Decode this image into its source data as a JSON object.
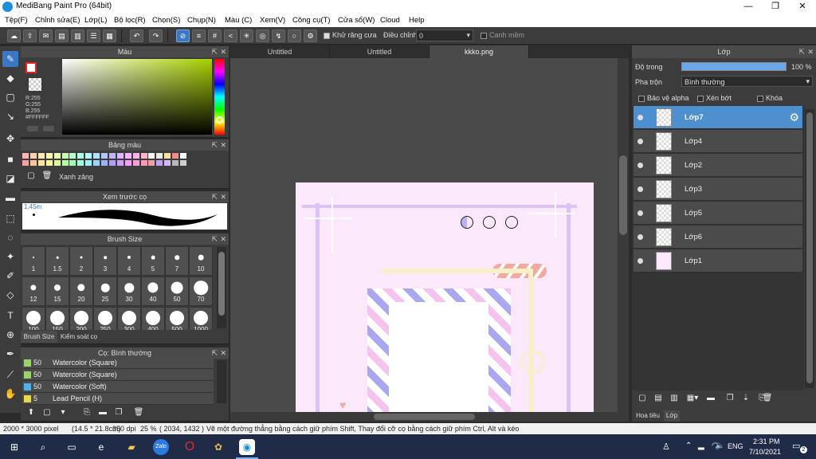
{
  "app": {
    "title": "MediBang Paint Pro (64bit)",
    "min": "—",
    "max": "❐",
    "close": "✕"
  },
  "menu": [
    "Tệp(F)",
    "Chỉnh sửa(E)",
    "Lớp(L)",
    "Bộ lọc(R)",
    "Chọn(S)",
    "Chụp(N)",
    "Màu (C)",
    "Xem(V)",
    "Công cụ(T)",
    "Cửa sổ(W)",
    "Cloud",
    "Help"
  ],
  "toolbar": {
    "antialias": "Khử răng cưa",
    "adjust_label": "Điều chỉnh",
    "adjust_value": "0",
    "smooth": "Canh mềm"
  },
  "color_panel": {
    "title": "Màu",
    "r": "R:255",
    "g": "G:255",
    "b": "B:255",
    "hex": "#FFFFFF"
  },
  "palette_panel": {
    "title": "Bảng màu",
    "name": "Xanh zảng"
  },
  "brush_preview": {
    "title": "Xem trước cọ",
    "size": "1.45m"
  },
  "brush_size": {
    "title": "Brush Size",
    "sizes": [
      "1",
      "1.5",
      "2",
      "3",
      "4",
      "5",
      "7",
      "10",
      "12",
      "15",
      "20",
      "25",
      "30",
      "40",
      "50",
      "70",
      "100",
      "150",
      "200",
      "250",
      "300",
      "400",
      "500",
      "1000"
    ],
    "tab1": "Brush Size",
    "tab2": "Kiểm soát cọ"
  },
  "brush_list": {
    "title": "Cọ: Bình thường",
    "items": [
      {
        "size": "50",
        "name": "Watercolor (Square)",
        "color": "#9ad36b"
      },
      {
        "size": "50",
        "name": "Watercolor (Square)",
        "color": "#9ad36b"
      },
      {
        "size": "50",
        "name": "Watercolor (Soft)",
        "color": "#4fb3e8"
      },
      {
        "size": "5",
        "name": "Lead Pencil (H)",
        "color": "#e8d84f"
      }
    ]
  },
  "tabs": [
    "Untitled",
    "Untitled",
    "kkko.png"
  ],
  "layer_panel": {
    "title": "Lớp",
    "opacity_label": "Độ trong",
    "opacity_value": "100 %",
    "blend_label": "Pha trộn",
    "blend_value": "Bình thường",
    "protect_alpha": "Bảo vệ alpha",
    "clipping": "Xén bớt",
    "lock": "Khóa",
    "layers": [
      "Lớp7",
      "Lớp4",
      "Lớp2",
      "Lớp3",
      "Lớp5",
      "Lớp6",
      "Lớp1"
    ],
    "tab1": "Hoa tiêu",
    "tab2": "Lớp"
  },
  "status": {
    "dims": "2000 * 3000 pixel",
    "cm": "(14.5 * 21.8cm)",
    "dpi": "350 dpi",
    "zoom": "25 %",
    "coords": "( 2034, 1432 )",
    "hint": "Vẽ một đường thẳng bằng cách giữ phím Shift, Thay đổi cỡ cọ bằng cách giữ phím Ctrl, Alt và kéo"
  },
  "taskbar": {
    "lang": "ENG",
    "time": "2:31 PM",
    "date": "7/10/2021",
    "notif": "2"
  }
}
